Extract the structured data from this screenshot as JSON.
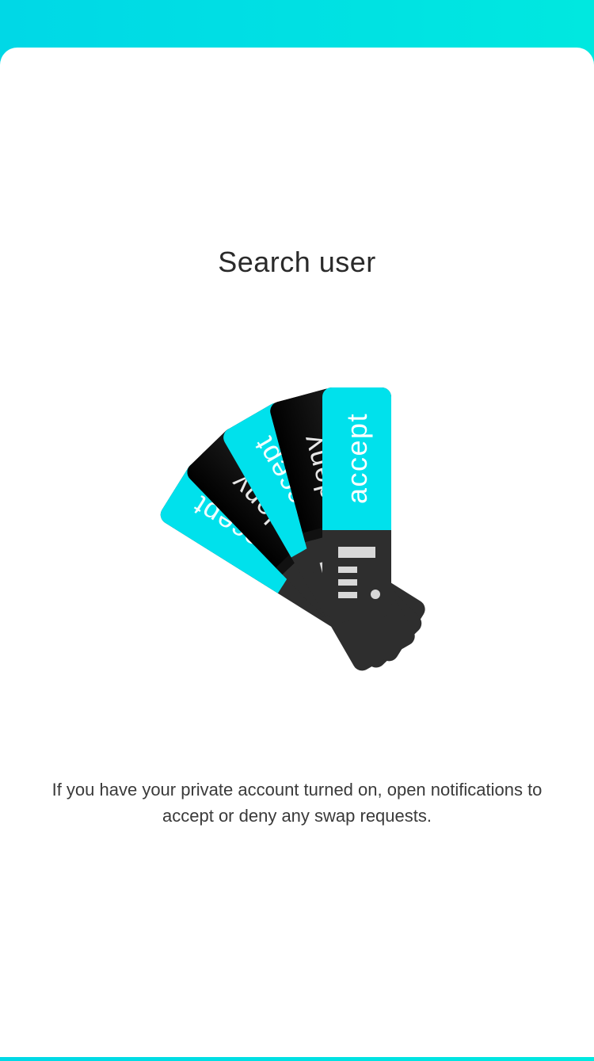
{
  "header": {
    "gradient_start": "#00d8e6",
    "gradient_end": "#00e8e0"
  },
  "main": {
    "title": "Search user",
    "message": "If you have your private account turned on, open notifications to accept or deny any swap requests."
  },
  "illustration": {
    "swatches": [
      {
        "label": "accept",
        "color": "#00e1ec"
      },
      {
        "label": "deny",
        "color": "#0f0f0f"
      },
      {
        "label": "accept",
        "color": "#00e1ec"
      },
      {
        "label": "deny",
        "color": "#0f0f0f"
      },
      {
        "label": "accept",
        "color": "#00e1ec"
      }
    ],
    "handle_color": "#2e2e2e",
    "detail_color": "#d8d8d8"
  }
}
